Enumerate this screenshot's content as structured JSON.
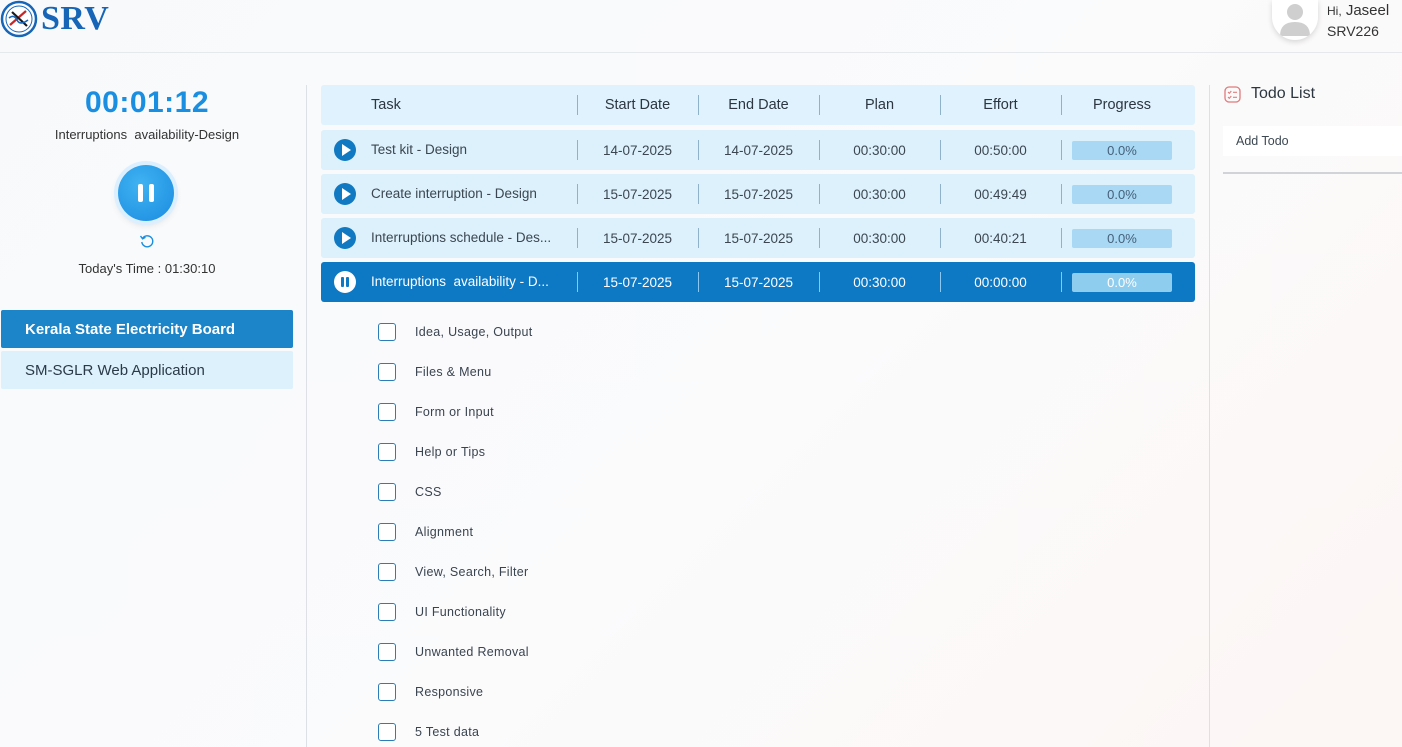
{
  "colors": {
    "brand": "#1665b7",
    "accent": "#1a8ee0",
    "active_row": "#0d78c4",
    "row_bg": "#dcf1fc",
    "project_active": "#1c84c8"
  },
  "header": {
    "logo_text": "SRV",
    "user": {
      "greeting_hi": "Hi,",
      "name": "Jaseel",
      "id": "SRV226"
    }
  },
  "timer": {
    "time": "00:01:12",
    "task": "Interruptions  availability-Design",
    "today": "Today's Time : 01:30:10"
  },
  "projects": [
    {
      "label": "Kerala State Electricity Board",
      "active": true
    },
    {
      "label": "SM-SGLR Web Application",
      "active": false
    }
  ],
  "table": {
    "headers": {
      "task": "Task",
      "start": "Start Date",
      "end": "End Date",
      "plan": "Plan",
      "effort": "Effort",
      "progress": "Progress"
    },
    "rows": [
      {
        "task": "Test kit - Design",
        "start": "14-07-2025",
        "end": "14-07-2025",
        "plan": "00:30:00",
        "effort": "00:50:00",
        "progress": "0.0%",
        "state": "play"
      },
      {
        "task": "Create interruption - Design",
        "start": "15-07-2025",
        "end": "15-07-2025",
        "plan": "00:30:00",
        "effort": "00:49:49",
        "progress": "0.0%",
        "state": "play"
      },
      {
        "task": "Interruptions schedule - Des...",
        "start": "15-07-2025",
        "end": "15-07-2025",
        "plan": "00:30:00",
        "effort": "00:40:21",
        "progress": "0.0%",
        "state": "play"
      },
      {
        "task": "Interruptions  availability - D...",
        "start": "15-07-2025",
        "end": "15-07-2025",
        "plan": "00:30:00",
        "effort": "00:00:00",
        "progress": "0.0%",
        "state": "pause"
      }
    ]
  },
  "checklist": [
    "Idea, Usage, Output",
    "Files & Menu",
    "Form or Input",
    "Help or Tips",
    "CSS",
    "Alignment",
    "View, Search, Filter",
    "UI Functionality",
    "Unwanted Removal",
    "Responsive",
    "5 Test data"
  ],
  "todo": {
    "title": "Todo List",
    "placeholder": "Add Todo"
  }
}
